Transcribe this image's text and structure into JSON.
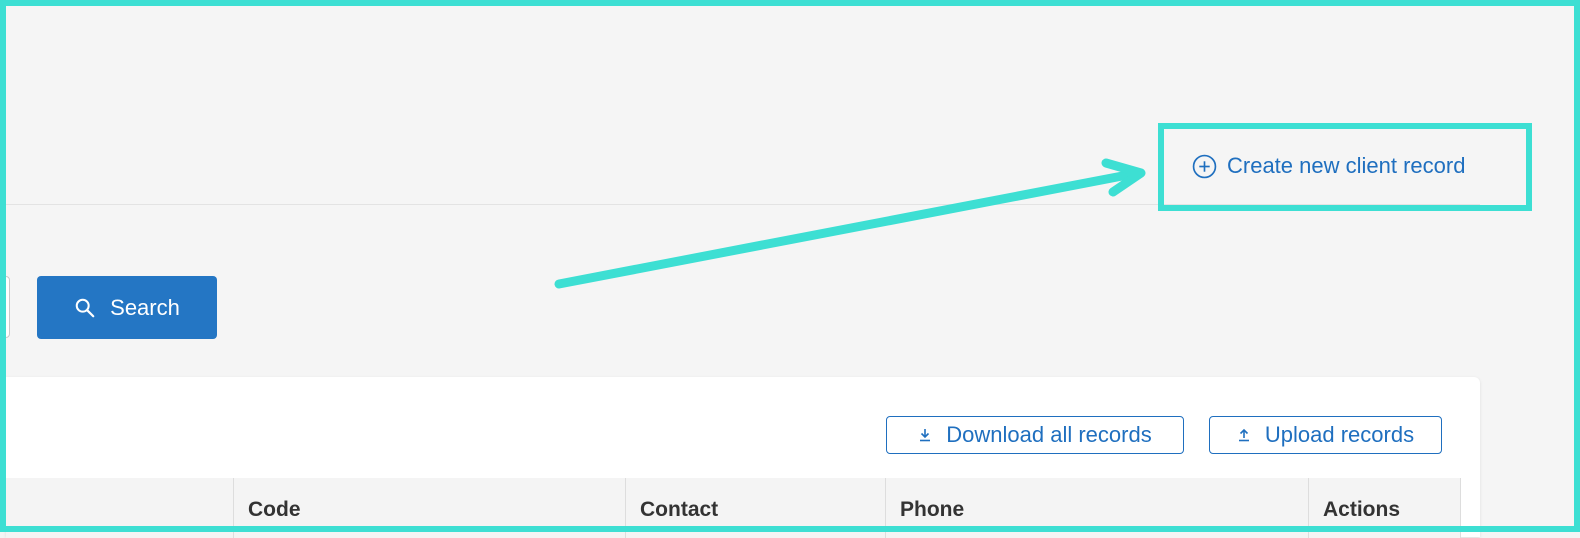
{
  "header": {
    "create_link_label": "Create new client record",
    "create_link_icon": "plus-circle-icon"
  },
  "search": {
    "button_label": "Search",
    "button_icon": "search-icon"
  },
  "toolbar": {
    "download_label": "Download all records",
    "download_icon": "download-icon",
    "upload_label": "Upload records",
    "upload_icon": "upload-icon"
  },
  "table": {
    "columns": [
      "Code",
      "Contact",
      "Phone",
      "Actions"
    ]
  },
  "colors": {
    "accent": "#1f6fbf",
    "primary_button": "#2476c4",
    "highlight": "#3ddfd3",
    "background": "#f5f5f5"
  }
}
